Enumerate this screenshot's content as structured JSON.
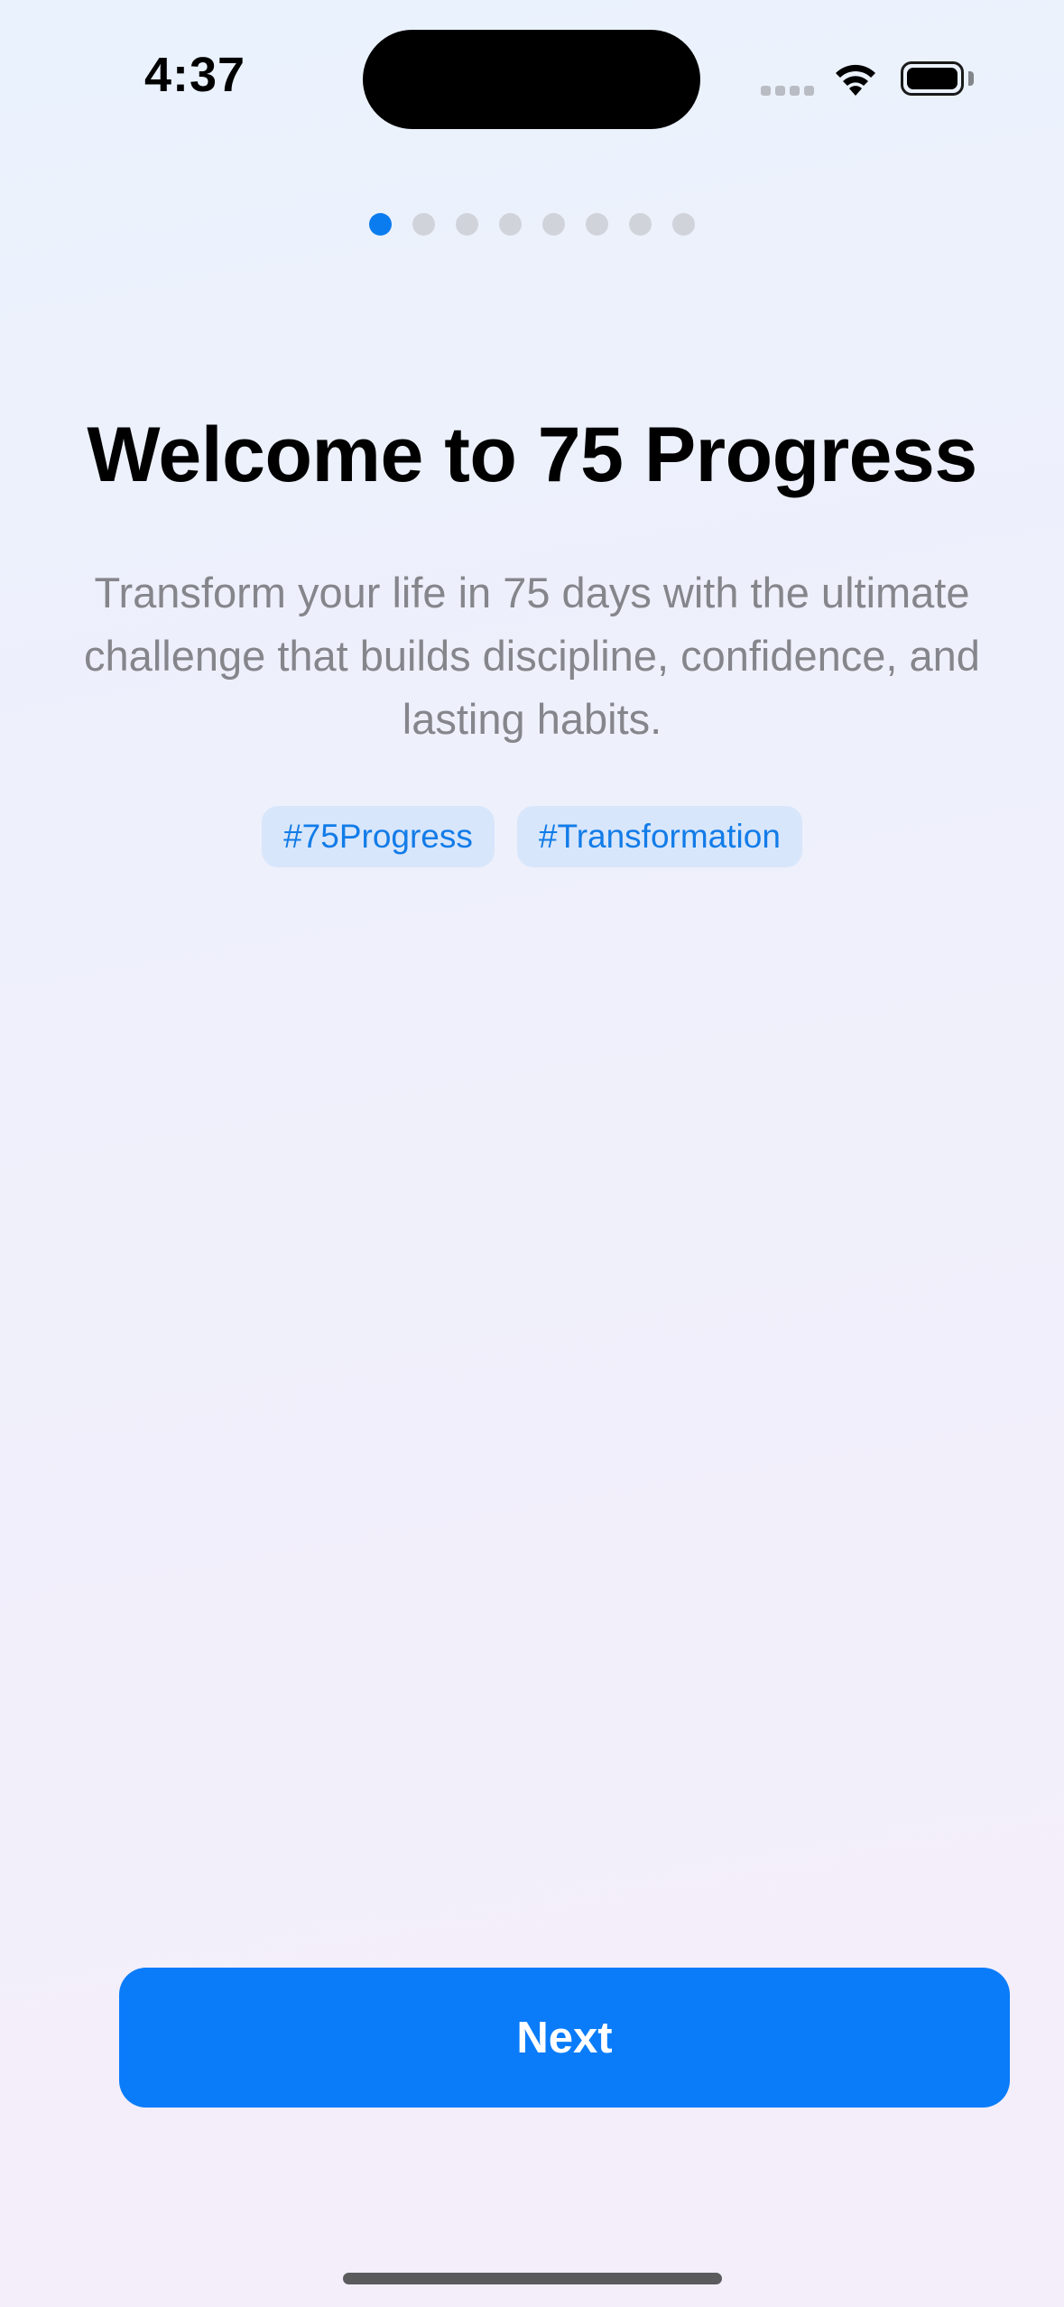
{
  "status_bar": {
    "time": "4:37",
    "icons": [
      "cellular-signal-icon",
      "wifi-icon",
      "battery-icon"
    ]
  },
  "page_indicator": {
    "total": 8,
    "current": 1,
    "active_color": "#0a7cf0",
    "inactive_color": "#d1d3da"
  },
  "onboarding": {
    "title": "Welcome to 75 Progress",
    "subtitle": "Transform your life in 75 days with the ultimate challenge that builds discipline, confidence, and lasting habits.",
    "tags": [
      "#75Progress",
      "#Transformation"
    ]
  },
  "next_button": {
    "label": "Next",
    "color": "#0a7cf9"
  }
}
